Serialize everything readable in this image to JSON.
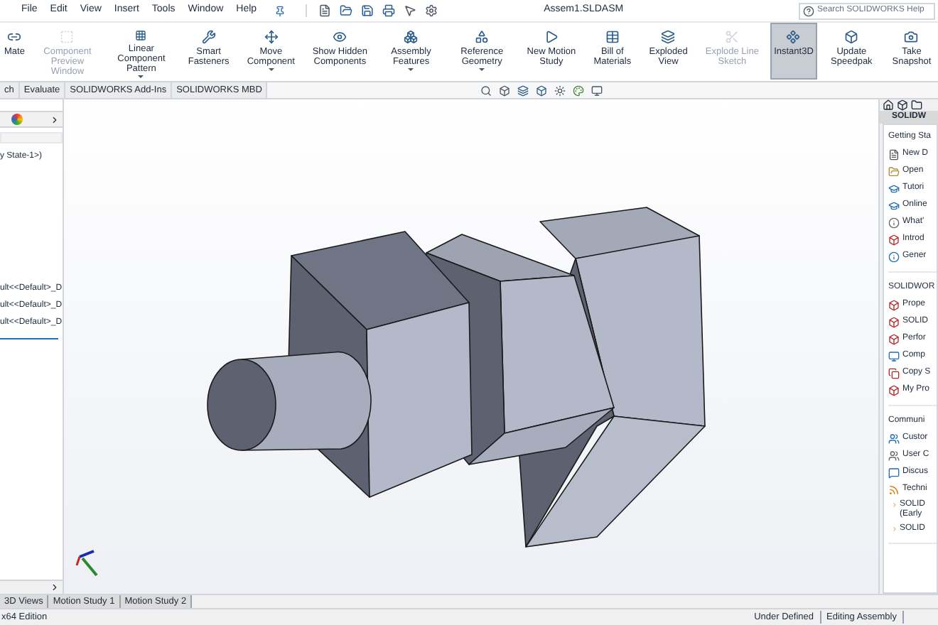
{
  "menu_bar": {
    "items": [
      "File",
      "Edit",
      "View",
      "Insert",
      "Tools",
      "Window",
      "Help"
    ],
    "title": "Assem1.SLDASM",
    "search": {
      "placeholder": "Search SOLIDWORKS Help"
    }
  },
  "ribbon": [
    {
      "label": "Mate",
      "disabled": false,
      "selected": false,
      "dropdown": false
    },
    {
      "label": "Component Preview Window",
      "disabled": true,
      "selected": false,
      "dropdown": false
    },
    {
      "label": "Linear Component Pattern",
      "disabled": false,
      "selected": false,
      "dropdown": true
    },
    {
      "label": "Smart Fasteners",
      "disabled": false,
      "selected": false,
      "dropdown": false
    },
    {
      "label": "Move Component",
      "disabled": false,
      "selected": false,
      "dropdown": true
    },
    {
      "label": "Show Hidden Components",
      "disabled": false,
      "selected": false,
      "dropdown": false
    },
    {
      "label": "Assembly Features",
      "disabled": false,
      "selected": false,
      "dropdown": true
    },
    {
      "label": "Reference Geometry",
      "disabled": false,
      "selected": false,
      "dropdown": true
    },
    {
      "label": "New Motion Study",
      "disabled": false,
      "selected": false,
      "dropdown": false
    },
    {
      "label": "Bill of Materials",
      "disabled": false,
      "selected": false,
      "dropdown": false
    },
    {
      "label": "Exploded View",
      "disabled": false,
      "selected": false,
      "dropdown": false
    },
    {
      "label": "Explode Line Sketch",
      "disabled": true,
      "selected": false,
      "dropdown": false
    },
    {
      "label": "Instant3D",
      "disabled": false,
      "selected": true,
      "dropdown": false
    },
    {
      "label": "Update Speedpak",
      "disabled": false,
      "selected": false,
      "dropdown": false
    },
    {
      "label": "Take Snapshot",
      "disabled": false,
      "selected": false,
      "dropdown": false
    }
  ],
  "command_tabs": [
    "ch",
    "Evaluate",
    "SOLIDWORKS Add-Ins",
    "SOLIDWORKS MBD"
  ],
  "feature_tree": {
    "state_text": "y State-1>)",
    "items": [
      "ult<<Default>_D",
      "ult<<Default>_D",
      "ult<<Default>_D"
    ]
  },
  "task_pane": {
    "title": "SOLIDW",
    "sections": [
      {
        "heading": "Getting Sta",
        "items": [
          {
            "label": "New D",
            "kind": "icon"
          },
          {
            "label": "Open",
            "kind": "icon"
          },
          {
            "label": "Tutori",
            "kind": "icon"
          },
          {
            "label": "Online",
            "kind": "icon"
          },
          {
            "label": "What'",
            "kind": "icon"
          },
          {
            "label": "Introd",
            "kind": "icon"
          },
          {
            "label": "Gener",
            "kind": "icon"
          }
        ]
      },
      {
        "heading": "SOLIDWOR",
        "items": [
          {
            "label": "Prope",
            "kind": "icon"
          },
          {
            "label": "SOLID",
            "kind": "icon"
          },
          {
            "label": "Perfor",
            "kind": "icon"
          },
          {
            "label": "Comp",
            "kind": "icon"
          },
          {
            "label": "Copy S",
            "kind": "icon"
          },
          {
            "label": "My Pro",
            "kind": "icon"
          }
        ]
      },
      {
        "heading": "Communi",
        "items": [
          {
            "label": "Custor",
            "kind": "icon"
          },
          {
            "label": "User C",
            "kind": "icon"
          },
          {
            "label": "Discus",
            "kind": "icon"
          },
          {
            "label": "Techni",
            "kind": "icon"
          },
          {
            "label": "SOLID (Early",
            "kind": "link"
          },
          {
            "label": "SOLID",
            "kind": "link"
          }
        ]
      }
    ]
  },
  "bottom_tabs": [
    "3D Views",
    "Motion Study 1",
    "Motion Study 2"
  ],
  "status_bar": [
    "x64 Edition",
    "Under Defined",
    "Editing Assembly"
  ]
}
